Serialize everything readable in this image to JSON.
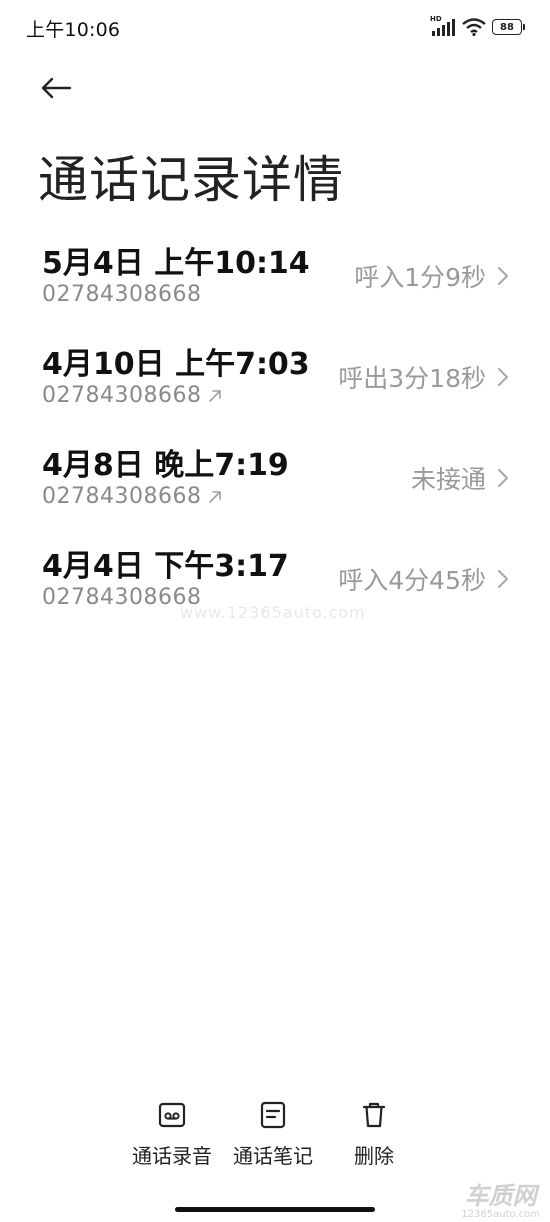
{
  "status_bar": {
    "time": "上午10:06",
    "hd_label": "HD",
    "battery": "88"
  },
  "page": {
    "title": "通话记录详情"
  },
  "calls": [
    {
      "datetime": "5月4日 上午10:14",
      "number": "02784308668",
      "outgoing_icon": false,
      "result": "呼入1分9秒"
    },
    {
      "datetime": "4月10日 上午7:03",
      "number": "02784308668",
      "outgoing_icon": true,
      "result": "呼出3分18秒"
    },
    {
      "datetime": "4月8日 晚上7:19",
      "number": "02784308668",
      "outgoing_icon": true,
      "result": "未接通"
    },
    {
      "datetime": "4月4日 下午3:17",
      "number": "02784308668",
      "outgoing_icon": false,
      "result": "呼入4分45秒"
    }
  ],
  "watermark": "www.12365auto.com",
  "actions": {
    "recording": "通话录音",
    "notes": "通话笔记",
    "delete": "删除"
  },
  "brand": {
    "name": "车质网",
    "site": "12365auto.com"
  },
  "icons": {
    "back": "back-arrow-icon",
    "signal": "signal-bars-icon",
    "wifi": "wifi-icon",
    "battery": "battery-icon",
    "outgoing": "outgoing-arrow-icon",
    "chevron": "chevron-right-icon",
    "recording": "voicemail-icon",
    "notes": "note-icon",
    "delete": "trash-icon"
  }
}
